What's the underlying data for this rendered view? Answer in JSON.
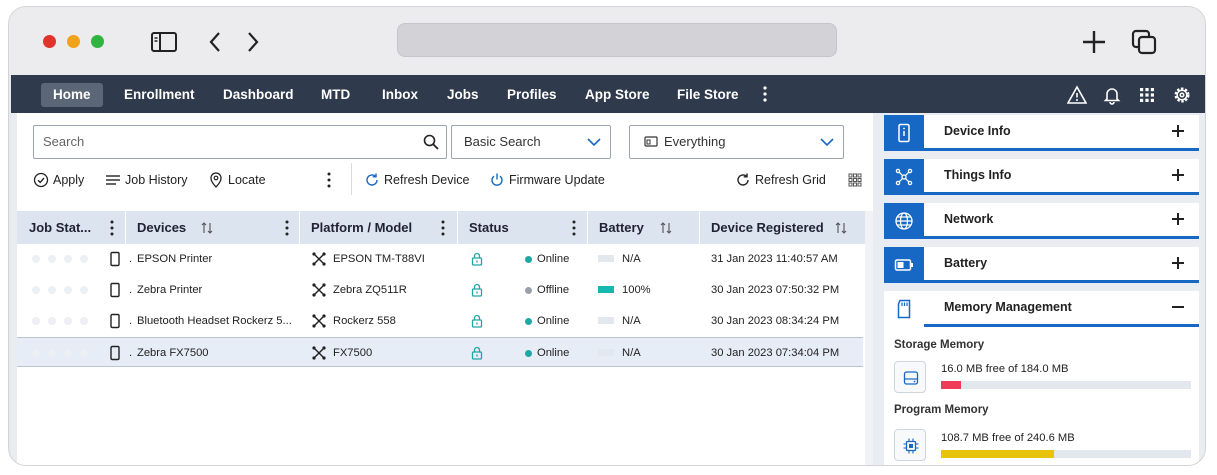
{
  "nav": {
    "items": [
      "Home",
      "Enrollment",
      "Dashboard",
      "MTD",
      "Inbox",
      "Jobs",
      "Profiles",
      "App Store",
      "File Store"
    ],
    "active": "Home"
  },
  "toolbar": {
    "search_placeholder": "Search",
    "search_mode": "Basic Search",
    "scope": "Everything",
    "actions": {
      "apply": "Apply",
      "job_history": "Job History",
      "locate": "Locate",
      "refresh_device": "Refresh Device",
      "firmware_update": "Firmware Update",
      "refresh_grid": "Refresh Grid"
    }
  },
  "table": {
    "columns": [
      "Job Stat...",
      "Devices",
      "Platform / Model",
      "Status",
      "Battery",
      "Device Registered"
    ],
    "rows": [
      {
        "device": "EPSON Printer",
        "model": "EPSON TM-T88VI",
        "status": "Online",
        "battery": "N/A",
        "battery_level": 0,
        "registered": "31 Jan 2023 11:40:57 AM"
      },
      {
        "device": "Zebra Printer",
        "model": "Zebra ZQ511R",
        "status": "Offline",
        "battery": "100%",
        "battery_level": 1,
        "registered": "30 Jan 2023 07:50:32 PM"
      },
      {
        "device": "Bluetooth Headset Rockerz 5...",
        "model": "Rockerz 558",
        "status": "Online",
        "battery": "N/A",
        "battery_level": 0,
        "registered": "30 Jan 2023 08:34:24 PM"
      },
      {
        "device": "Zebra FX7500",
        "model": "FX7500",
        "status": "Online",
        "battery": "N/A",
        "battery_level": 0,
        "registered": "30 Jan 2023 07:34:04 PM"
      }
    ],
    "colors": {
      "online": "#1ea7a4",
      "offline": "#9aa0a8",
      "battery": "#17b8b0",
      "battery_empty": "#e3e8ef"
    }
  },
  "panel": {
    "sections": [
      "Device Info",
      "Things Info",
      "Network",
      "Battery",
      "Memory Management"
    ],
    "memory": {
      "storage_label": "Storage Memory",
      "storage_text": "16.0 MB free of 184.0 MB",
      "storage_fill": 0.08,
      "storage_color": "#ef3b55",
      "program_label": "Program Memory",
      "program_text": "108.7 MB free of 240.6 MB",
      "program_fill": 0.45,
      "program_color": "#e6c40c"
    }
  }
}
